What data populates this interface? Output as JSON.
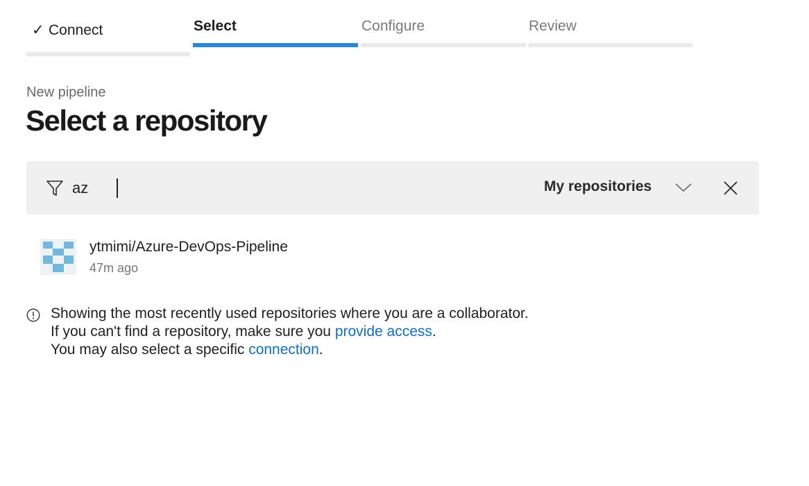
{
  "stepper": {
    "steps": [
      {
        "label": "Connect",
        "state": "completed"
      },
      {
        "label": "Select",
        "state": "active"
      },
      {
        "label": "Configure",
        "state": "upcoming"
      },
      {
        "label": "Review",
        "state": "upcoming"
      }
    ],
    "check_icon": "✓"
  },
  "header": {
    "subtitle": "New pipeline",
    "title": "Select a repository"
  },
  "filter": {
    "icon": "filter-icon",
    "value": "az",
    "placeholder": "",
    "scope_label": "My repositories",
    "clear_icon": "close-icon"
  },
  "repositories": [
    {
      "name": "ytmimi/Azure-DevOps-Pipeline",
      "time": "47m ago",
      "avatar_color": "#72b7dc"
    }
  ],
  "info": {
    "line1": "Showing the most recently used repositories where you are a collaborator.",
    "line2_prefix": "If you can't find a repository, make sure you ",
    "line2_link": "provide access",
    "line2_suffix": ".",
    "line3_prefix": "You may also select a specific ",
    "line3_link": "connection",
    "line3_suffix": "."
  },
  "colors": {
    "accent": "#2b88d8",
    "link": "#106ebe",
    "filter_bg": "#f0f0f0"
  }
}
